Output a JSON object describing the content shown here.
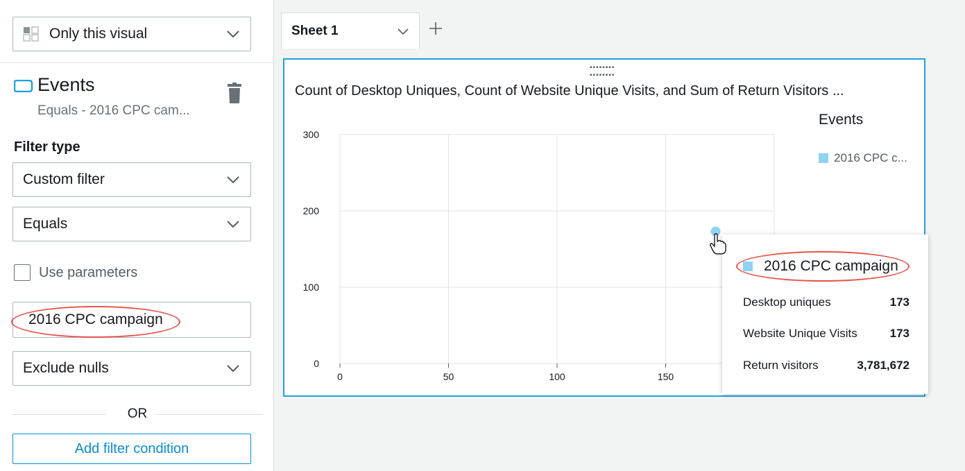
{
  "left_panel": {
    "scope_select": "Only this visual",
    "field": {
      "name": "Events",
      "summary": "Equals - 2016 CPC cam..."
    },
    "filter_type_label": "Filter type",
    "filter_type_value": "Custom filter",
    "operator_value": "Equals",
    "use_parameters_label": "Use parameters",
    "value_input": "2016 CPC campaign",
    "nulls_value": "Exclude nulls",
    "or_label": "OR",
    "add_condition_label": "Add filter condition"
  },
  "tabs": [
    {
      "label": "Sheet 1"
    }
  ],
  "visual": {
    "title": "Count of Desktop Uniques, Count of Website Unique Visits, and Sum of Return Visitors ...",
    "legend_title": "Events",
    "legend_item": "2016 CPC c..."
  },
  "tooltip": {
    "header": "2016 CPC campaign",
    "rows": [
      {
        "label": "Desktop uniques",
        "value": "173"
      },
      {
        "label": "Website Unique Visits",
        "value": "173"
      },
      {
        "label": "Return visitors",
        "value": "3,781,672"
      }
    ]
  },
  "colors": {
    "accent": "#1ea1e3",
    "series": "#8fd3f0",
    "highlight": "#e8534a",
    "button": "#0a8bd6"
  },
  "chart_data": {
    "type": "scatter",
    "x_ticks": [
      "0",
      "50",
      "100",
      "150"
    ],
    "y_ticks": [
      "0",
      "100",
      "200",
      "300"
    ],
    "xlim": [
      0,
      200
    ],
    "ylim": [
      0,
      300
    ],
    "grid": true,
    "legend_placement": "right",
    "series": [
      {
        "name": "2016 CPC campaign",
        "points": [
          {
            "x": 173,
            "y": 173
          }
        ]
      }
    ]
  }
}
